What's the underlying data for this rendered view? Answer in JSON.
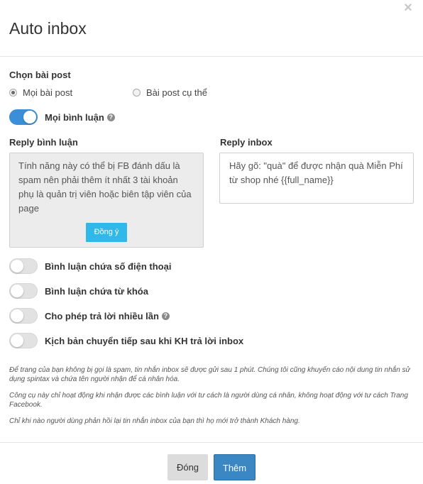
{
  "modal": {
    "title": "Auto inbox",
    "close_icon": "close-icon"
  },
  "post_select": {
    "label": "Chọn bài post",
    "options": [
      {
        "label": "Mọi bài post",
        "checked": true
      },
      {
        "label": "Bài post cụ thể",
        "checked": false
      }
    ]
  },
  "all_comments": {
    "label": "Mọi bình luận",
    "on": true,
    "help_icon": "?"
  },
  "reply_comment": {
    "label": "Reply bình luận",
    "notice": "Tính năng này có thể bị FB đánh dấu là spam nên phải thêm ít nhất 3 tài khoản phụ là quản trị viên hoặc biên tập viên của page",
    "agree_label": "Đồng ý"
  },
  "reply_inbox": {
    "label": "Reply inbox",
    "value": "Hãy gõ: \"quà\" để được nhận quà Miễn Phí từ shop nhé {{full_name}}"
  },
  "toggles": [
    {
      "label": "Bình luận chứa số điện thoại",
      "on": false,
      "help": false
    },
    {
      "label": "Bình luận chứa từ khóa",
      "on": false,
      "help": false
    },
    {
      "label": "Cho phép trả lời nhiều lần",
      "on": false,
      "help": true
    },
    {
      "label": "Kịch bản chuyển tiếp sau khi KH trả lời inbox",
      "on": false,
      "help": false
    }
  ],
  "help_glyph": "?",
  "notes": [
    "Để trang của bạn không bị gọi là spam, tin nhắn inbox sẽ được gửi sau 1 phút. Chúng tôi cũng khuyến cáo nội dung tin nhắn sử dụng spintax và chứa tên người nhận để cá nhân hóa.",
    "Công cụ này chỉ hoạt động khi nhận được các bình luận với tư cách là người dùng cá nhân, không hoạt động với tư cách Trang Facebook.",
    "Chỉ khi nào người dùng phản hồi lại tin nhắn inbox của bạn thì họ mới trở thành Khách hàng."
  ],
  "footer": {
    "close_label": "Đóng",
    "add_label": "Thêm"
  },
  "colors": {
    "toggle_on": "#3a8fd8",
    "agree_button": "#2fb8e8",
    "primary_button": "#3a87c4"
  }
}
